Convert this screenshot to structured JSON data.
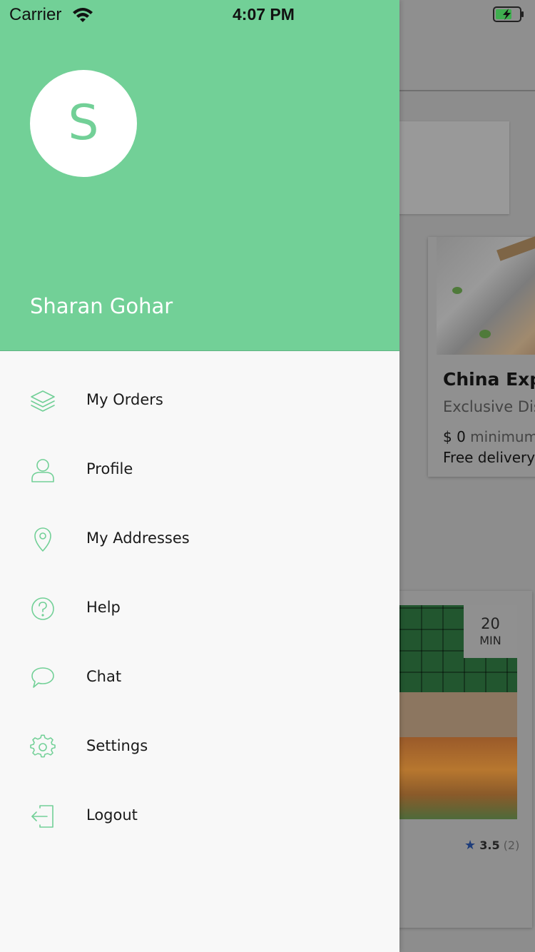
{
  "status_bar": {
    "carrier": "Carrier",
    "time": "4:07 PM"
  },
  "colors": {
    "accent": "#72D097",
    "menu_bg": "#F8F8F8",
    "overlay": "#8D8D8D"
  },
  "drawer": {
    "avatar_initial": "S",
    "user_name": "Sharan Gohar",
    "menu": [
      {
        "label": "My Orders",
        "icon": "layers-icon"
      },
      {
        "label": "Profile",
        "icon": "user-icon"
      },
      {
        "label": "My Addresses",
        "icon": "location-pin-icon"
      },
      {
        "label": "Help",
        "icon": "help-circle-icon"
      },
      {
        "label": "Chat",
        "icon": "chat-bubble-icon"
      },
      {
        "label": "Settings",
        "icon": "gear-icon"
      },
      {
        "label": "Logout",
        "icon": "logout-icon"
      }
    ]
  },
  "background": {
    "restaurant_card": {
      "title": "China Expr",
      "subtitle": "Exclusive Dis",
      "minimum_value": "$ 0",
      "minimum_label": "minimum",
      "delivery": "Free delivery"
    },
    "second_card": {
      "time_value": "20",
      "time_unit": "MIN",
      "rating": "3.5",
      "rating_count": "(2)"
    }
  }
}
